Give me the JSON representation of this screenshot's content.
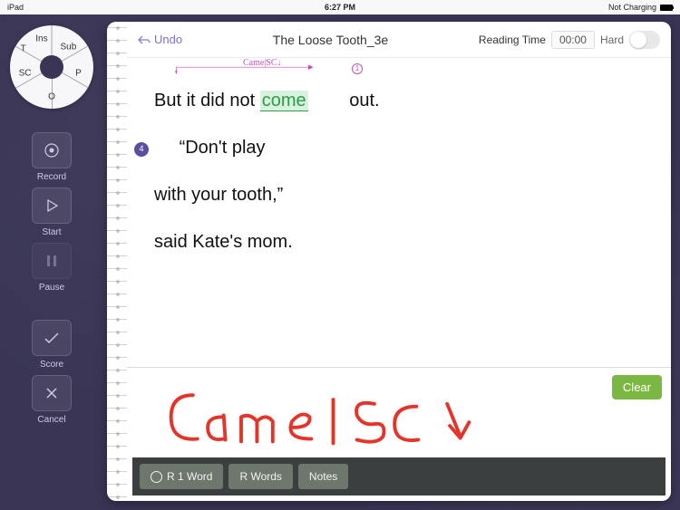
{
  "status": {
    "left": "iPad",
    "center": "6:27 PM",
    "right": "Not Charging"
  },
  "wheel": {
    "labels": {
      "ins": "Ins",
      "sub": "Sub",
      "p": "P",
      "o": "O",
      "sc": "SC",
      "t": "T"
    }
  },
  "sidebar": {
    "record": "Record",
    "start": "Start",
    "pause": "Pause",
    "score": "Score",
    "cancel": "Cancel"
  },
  "header": {
    "undo": "Undo",
    "title": "The Loose Tooth_3e",
    "reading_time_label": "Reading Time",
    "reading_time_value": "00:00",
    "hard": "Hard"
  },
  "reading": {
    "annotation_top": "Came|SC↓",
    "annotation_index": "1",
    "line1_pre": "But it did not ",
    "line1_hl": "come",
    "line1_post": " out.",
    "badge": "4",
    "line2": "“Don't play",
    "line3": "with your tooth,”",
    "line4": "said Kate's mom."
  },
  "handwriting": {
    "clear": "Clear",
    "scribble": "Came|sc↓"
  },
  "bottombar": {
    "r1word": "R 1 Word",
    "rwords": "R Words",
    "notes": "Notes"
  }
}
